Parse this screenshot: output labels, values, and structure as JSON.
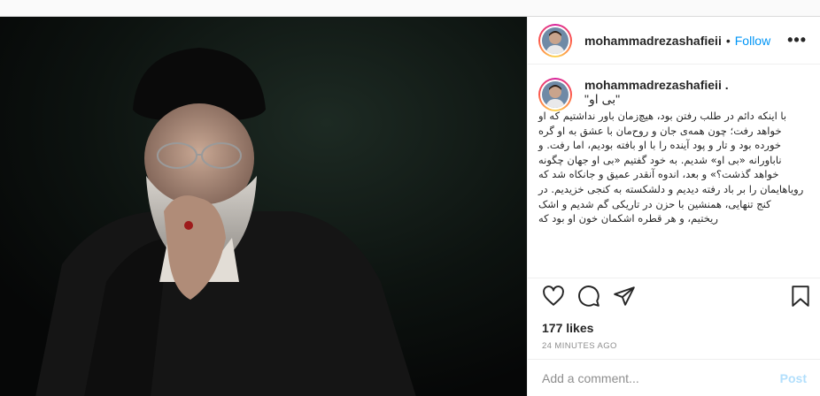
{
  "post": {
    "author": {
      "username": "mohammadrezashafieii",
      "separator": "•",
      "follow_label": "Follow"
    },
    "more_label": "•••",
    "caption": {
      "username": "mohammadrezashafieii .",
      "title": "\"بی او\"",
      "text": "با اینکه دائم در طلب رفتن بود، هیچ‌زمان باور نداشتیم که او خواهد رفت؛ چون همه‌ی جان و روح‌مان با عشق به او گره خورده بود و تار و پود آینده را با او بافته بودیم، اما رفت. و ناباورانه «بی او» شدیم. به خود گفتیم «بی او جهان چگونه خواهد گذشت؟» و بعد، اندوه آنقدر عمیق و جانکاه شد که رویاهایمان را بر باد رفته دیدیم و دلشکسته به کنجی خزیدیم. در کنج تنهایی، همنشین با حزن در تاریکی گم شدیم و اشک ریختیم، و هر قطره اشکمان خون او بود که"
    },
    "likes_text": "177 likes",
    "timestamp": "24 MINUTES AGO",
    "comment_placeholder": "Add a comment...",
    "post_label": "Post",
    "icons": {
      "like": "heart-icon",
      "comment": "comment-icon",
      "share": "share-icon",
      "save": "bookmark-icon",
      "more": "more-options-icon"
    },
    "colors": {
      "follow": "#0095f6",
      "post_disabled": "#b2dffc",
      "muted": "#8e8e8e"
    }
  }
}
